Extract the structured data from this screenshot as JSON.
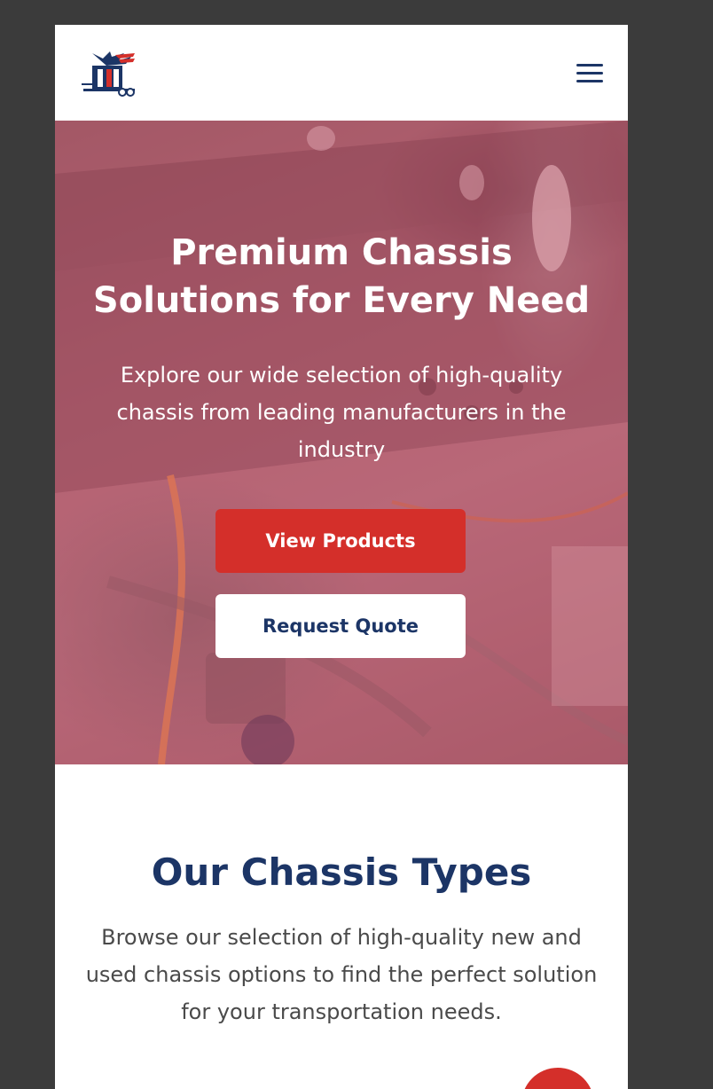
{
  "header": {
    "logo_icon": "eagle-chassis-logo-icon",
    "menu_icon": "hamburger-menu-icon"
  },
  "hero": {
    "title": "Premium Chassis Solutions for Every Need",
    "subtitle": "Explore our wide selection of high-quality chassis from leading manufacturers in the industry",
    "primary_button": "View Products",
    "secondary_button": "Request Quote"
  },
  "chassis_types": {
    "title": "Our Chassis Types",
    "description": "Browse our selection of high-quality new and used chassis options to find the perfect solution for your transportation needs."
  },
  "colors": {
    "navy": "#1c3566",
    "red": "#d42f2a",
    "backdrop": "#3b3b3b",
    "overlay": "#c45466"
  }
}
